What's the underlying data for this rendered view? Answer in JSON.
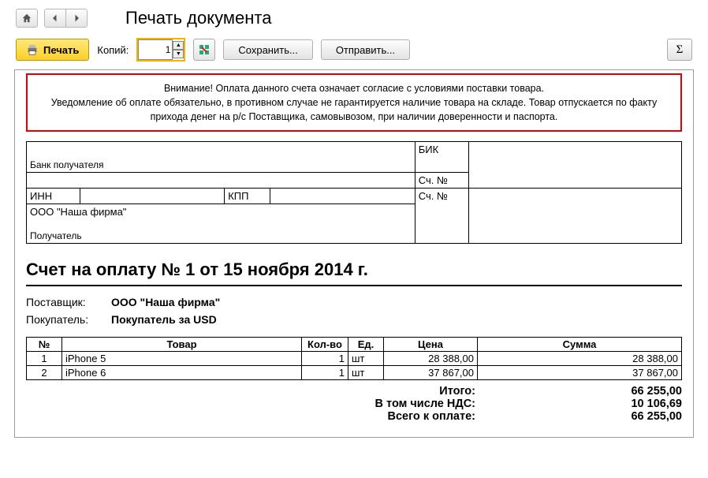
{
  "header": {
    "title": "Печать документа"
  },
  "toolbar": {
    "print_label": "Печать",
    "copies_label": "Копий:",
    "copies_value": "1",
    "save_label": "Сохранить...",
    "send_label": "Отправить...",
    "sigma": "Σ"
  },
  "warning": {
    "line1": "Внимание! Оплата данного счета означает согласие с условиями поставки товара.",
    "line2": "Уведомление об оплате обязательно, в противном случае не гарантируется наличие товара на складе. Товар отпускается по факту прихода денег на р/с Поставщика, самовывозом, при наличии доверенности и паспорта."
  },
  "bank": {
    "recipient_bank_label": "Банк получателя",
    "bik_label": "БИК",
    "acct_label": "Сч. №",
    "inn_label": "ИНН",
    "kpp_label": "КПП",
    "company": "ООО \"Наша фирма\"",
    "recipient_label": "Получатель"
  },
  "doc_title": "Счет на оплату № 1 от 15 ноября 2014 г.",
  "supplier": {
    "label": "Поставщик:",
    "value": "ООО \"Наша фирма\""
  },
  "buyer": {
    "label": "Покупатель:",
    "value": "Покупатель за USD"
  },
  "columns": {
    "n": "№",
    "name": "Товар",
    "qty": "Кол-во",
    "unit": "Ед.",
    "price": "Цена",
    "sum": "Сумма"
  },
  "items": [
    {
      "n": "1",
      "name": "iPhone 5",
      "qty": "1",
      "unit": "шт",
      "price": "28 388,00",
      "sum": "28 388,00"
    },
    {
      "n": "2",
      "name": "iPhone 6",
      "qty": "1",
      "unit": "шт",
      "price": "37 867,00",
      "sum": "37 867,00"
    }
  ],
  "totals": {
    "itogo_label": "Итого:",
    "itogo_value": "66 255,00",
    "vat_label": "В том числе НДС:",
    "vat_value": "10 106,69",
    "grand_label": "Всего к оплате:",
    "grand_value": "66 255,00"
  }
}
